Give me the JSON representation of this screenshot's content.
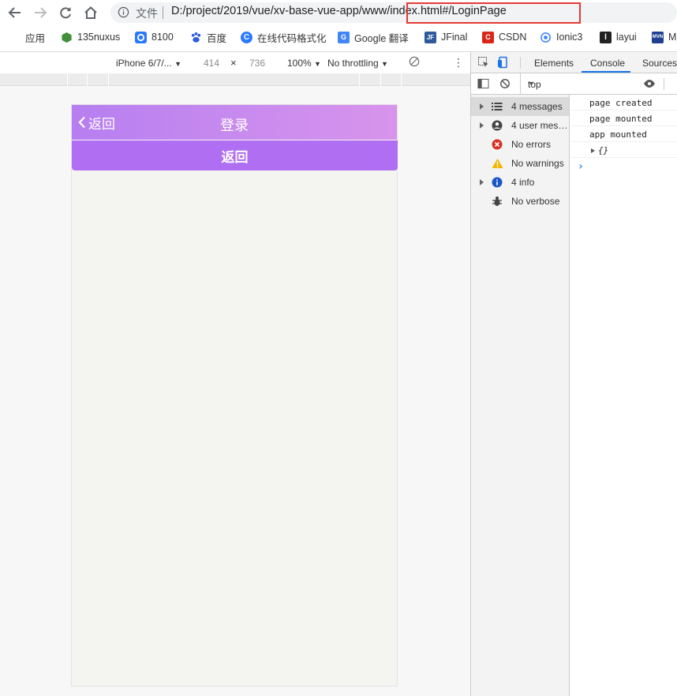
{
  "browser": {
    "scheme_label": "文件",
    "url_prefix": "D:/project/2019/vue/xv-base-vue-app/www/",
    "url_highlight": "index.html#/LoginPage"
  },
  "bookmarks": [
    {
      "label": "应用",
      "icon": "apps-grid-icon"
    },
    {
      "label": "135nuxus",
      "icon": "nexus-hex-icon",
      "color": "#3f8f3a"
    },
    {
      "label": "8100",
      "icon": "ring-icon",
      "color": "#2979ff"
    },
    {
      "label": "百度",
      "icon": "baidu-paw-icon",
      "color": "#2d5bd8"
    },
    {
      "label": "在线代码格式化",
      "icon": "c-logo-icon",
      "color": "#2979ff"
    },
    {
      "label": "Google 翻译",
      "icon": "google-translate-icon",
      "color": "#4285f4"
    },
    {
      "label": "JFinal",
      "icon": "jfinal-icon",
      "color": "#2e5a9a",
      "glyph": "JF"
    },
    {
      "label": "CSDN",
      "icon": "csdn-icon",
      "color": "#d8261b",
      "glyph": "C"
    },
    {
      "label": "Ionic3",
      "icon": "ionic-icon",
      "color": "#3880ff"
    },
    {
      "label": "layui",
      "icon": "layui-icon",
      "color": "#222222"
    },
    {
      "label": "M",
      "icon": "mvn-icon",
      "color": "#1f3f8f",
      "glyph": "MVN"
    }
  ],
  "device_toolbar": {
    "device": "iPhone 6/7/...",
    "width": "414",
    "times": "×",
    "height": "736",
    "zoom": "100%",
    "throttle": "No throttling"
  },
  "phone": {
    "back_label": "返回",
    "title": "登录",
    "back_button": "返回",
    "header_color": "#c98bee",
    "button_color": "#b06ff3"
  },
  "devtools": {
    "tabs": [
      "Elements",
      "Console",
      "Sources"
    ],
    "active_tab": "Console",
    "context": "top",
    "sidebar": [
      {
        "label": "4 messages",
        "icon": "list-icon",
        "expandable": true,
        "selected": true
      },
      {
        "label": "4 user mess...",
        "icon": "user-icon",
        "expandable": true
      },
      {
        "label": "No errors",
        "icon": "error-icon",
        "expandable": false
      },
      {
        "label": "No warnings",
        "icon": "warning-icon",
        "expandable": false
      },
      {
        "label": "4 info",
        "icon": "info-icon",
        "expandable": true
      },
      {
        "label": "No verbose",
        "icon": "bug-icon",
        "expandable": false
      }
    ],
    "logs": [
      "page created",
      "page mounted",
      "app mounted",
      "{}"
    ],
    "prompt": "›"
  }
}
